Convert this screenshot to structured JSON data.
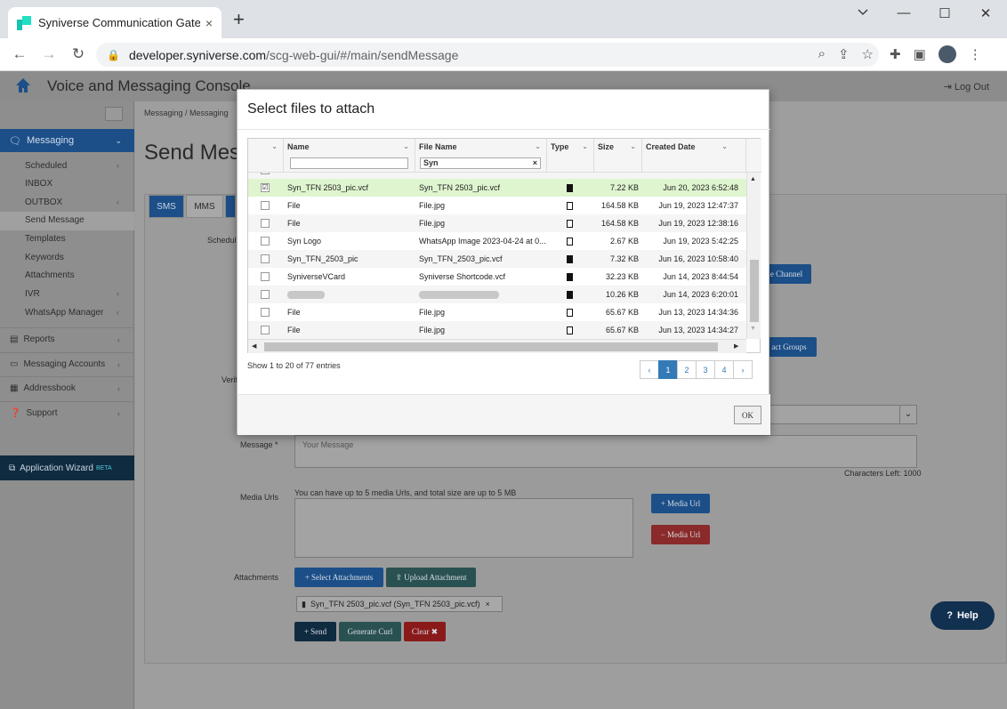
{
  "browser": {
    "tab_title": "Syniverse Communication Gatew",
    "tab_close": "×",
    "new_tab": "+",
    "url_host": "developer.syniverse.com",
    "url_path": "/scg-web-gui/#/main/sendMessage",
    "minimize": "—",
    "maximize": "☐",
    "close": "✕"
  },
  "header": {
    "title": "Voice and Messaging Console",
    "logout": "Log Out"
  },
  "sidebar": {
    "messaging": "Messaging",
    "items": [
      {
        "label": "Scheduled",
        "chev": "‹"
      },
      {
        "label": "INBOX",
        "chev": ""
      },
      {
        "label": "OUTBOX",
        "chev": "‹"
      },
      {
        "label": "Send Message",
        "chev": ""
      },
      {
        "label": "Templates",
        "chev": ""
      },
      {
        "label": "Keywords",
        "chev": ""
      },
      {
        "label": "Attachments",
        "chev": ""
      },
      {
        "label": "IVR",
        "chev": "‹"
      },
      {
        "label": "WhatsApp Manager",
        "chev": "‹"
      }
    ],
    "sections": [
      "Reports",
      "Messaging Accounts",
      "Addressbook",
      "Support"
    ],
    "wizard": "Application Wizard",
    "wizard_badge": "BETA"
  },
  "main": {
    "breadcrumb": "Messaging / Messaging",
    "page_title": "Send Mess",
    "tabs": [
      "SMS",
      "MMS"
    ],
    "labels": {
      "schedule": "Schedul",
      "verify": "Verif",
      "message": "Message *",
      "media_urls": "Media Urls",
      "attachments": "Attachments"
    },
    "channel_btn": "e Channel",
    "contact_groups_btn": "act Groups",
    "message_placeholder": "Your Message",
    "chars_left": "Characters Left: 1000",
    "media_hint": "You can have up to 5 media Urls, and total size are up to 5 MB",
    "add_media_url": "+ Media Url",
    "remove_media_url": "− Media Url",
    "select_attachments": "+ Select Attachments",
    "upload_attachment": "⇪ Upload Attachment",
    "attachment_chip": "Syn_TFN 2503_pic.vcf (Syn_TFN 2503_pic.vcf)",
    "send": "+ Send",
    "generate_curl": "Generate Curl",
    "clear": "Clear ✖",
    "help": "Help"
  },
  "modal": {
    "title": "Select files to attach",
    "columns": [
      "Name",
      "File Name",
      "Type",
      "Size",
      "Created Date"
    ],
    "filter_value": "Syn",
    "rows": [
      {
        "name": "Syn_TFN 2503_pic.vcf",
        "file": "Syn_TFN 2503_pic.vcf",
        "type": "doc",
        "size": "7.22 KB",
        "date": "Jun 20, 2023 6:52:48",
        "checked": "☑"
      },
      {
        "name": "File",
        "file": "File.jpg",
        "type": "img",
        "size": "164.58 KB",
        "date": "Jun 19, 2023 12:47:37",
        "checked": ""
      },
      {
        "name": "File",
        "file": "File.jpg",
        "type": "img",
        "size": "164.58 KB",
        "date": "Jun 19, 2023 12:38:16",
        "checked": ""
      },
      {
        "name": "Syn Logo",
        "file": "WhatsApp Image 2023-04-24 at 0...",
        "type": "img",
        "size": "2.67 KB",
        "date": "Jun 19, 2023 5:42:25",
        "checked": ""
      },
      {
        "name": "Syn_TFN_2503_pic",
        "file": "Syn_TFN_2503_pic.vcf",
        "type": "doc",
        "size": "7.32 KB",
        "date": "Jun 16, 2023 10:58:40",
        "checked": ""
      },
      {
        "name": "SyniverseVCard",
        "file": "Syniverse Shortcode.vcf",
        "type": "doc",
        "size": "32.23 KB",
        "date": "Jun 14, 2023 8:44:54",
        "checked": ""
      },
      {
        "name": "",
        "file": "",
        "type": "doc",
        "size": "10.26 KB",
        "date": "Jun 14, 2023 6:20:01",
        "checked": ""
      },
      {
        "name": "File",
        "file": "File.jpg",
        "type": "img",
        "size": "65.67 KB",
        "date": "Jun 13, 2023 14:34:36",
        "checked": ""
      },
      {
        "name": "File",
        "file": "File.jpg",
        "type": "img",
        "size": "65.67 KB",
        "date": "Jun 13, 2023 14:34:27",
        "checked": ""
      }
    ],
    "info": "Show 1 to 20 of 77 entries",
    "pages": [
      "‹",
      "1",
      "2",
      "3",
      "4",
      "›"
    ],
    "ok": "OK"
  },
  "colors": {
    "primary": "#337ab7",
    "selected_row": "#dff5cf",
    "brand": "#17c3b2"
  }
}
